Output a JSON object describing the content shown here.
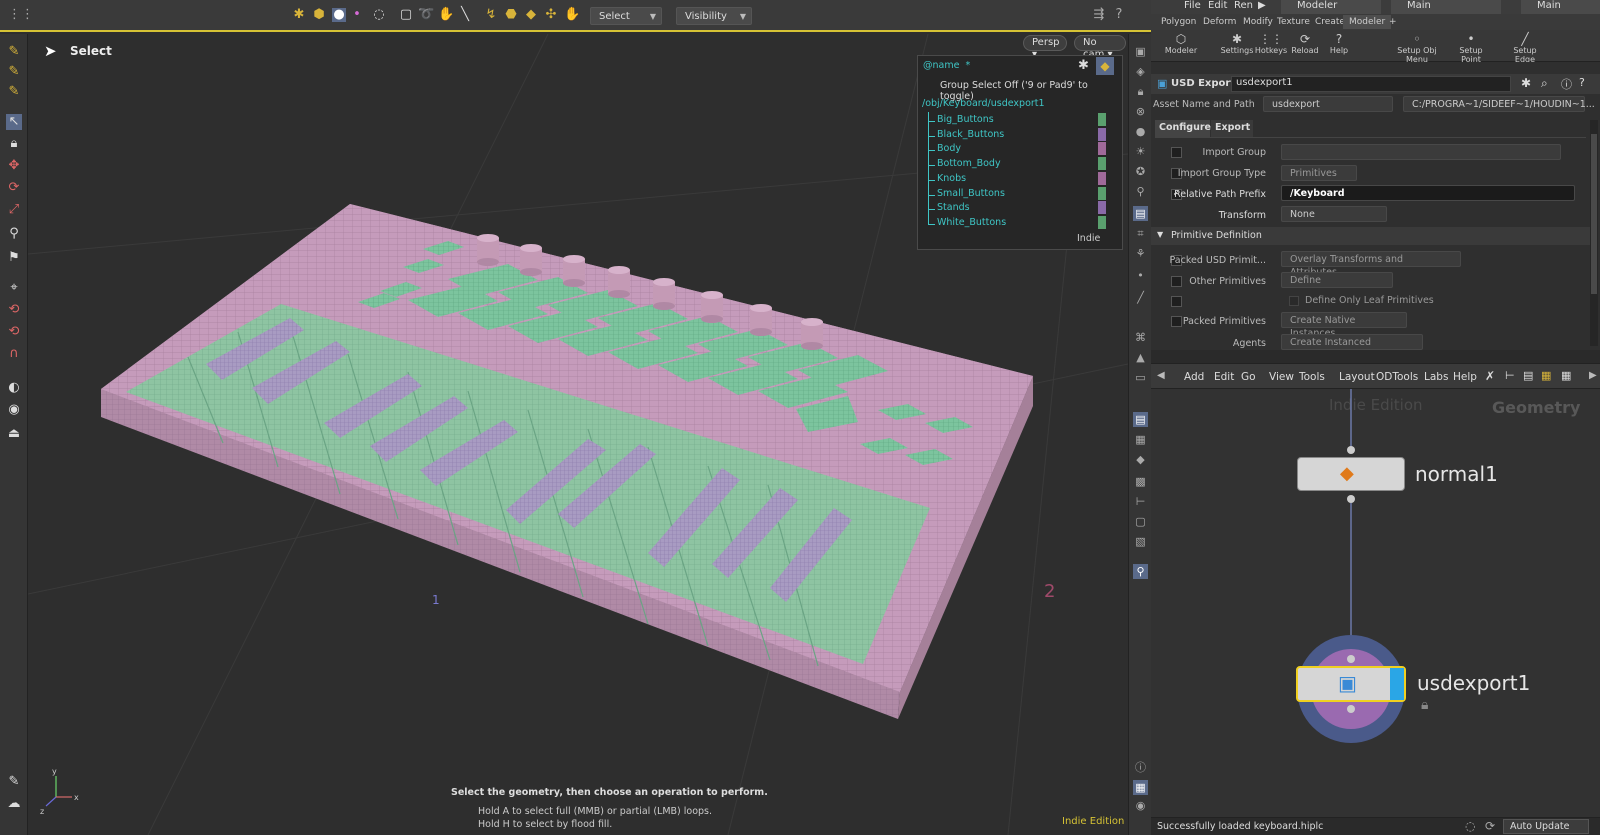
{
  "viewport": {
    "tool_title": "Select",
    "selection_mode": "Select",
    "visibility": "Visibility",
    "persp": "Persp",
    "cam": "No cam",
    "hint_main": "Select the geometry, then choose an operation to perform.",
    "hint_line1": "Hold A to select full (MMB) or partial (LMB) loops.",
    "hint_line2": "Hold H to select by flood fill.",
    "edition": "Indie Edition",
    "grid_labels": [
      "1",
      "2"
    ],
    "axis_labels": {
      "y": "y",
      "x": "x",
      "z": "z"
    }
  },
  "outliner": {
    "filter": "@name",
    "filter_wildcard": "*",
    "group_select": "Group Select Off ('9 or Pad9' to toggle)",
    "root": "/obj/Keyboard/usdexport1",
    "items": [
      {
        "label": "Big_Buttons",
        "color": "#5aa06e"
      },
      {
        "label": "Black_Buttons",
        "color": "#8a6aa8"
      },
      {
        "label": "Body",
        "color": "#a06a9a"
      },
      {
        "label": "Bottom_Body",
        "color": "#5aa06e"
      },
      {
        "label": "Knobs",
        "color": "#a06a9a"
      },
      {
        "label": "Small_Buttons",
        "color": "#5aa06e"
      },
      {
        "label": "Stands",
        "color": "#8a6aa8"
      },
      {
        "label": "White_Buttons",
        "color": "#5aa06e"
      }
    ],
    "badge": "Indie"
  },
  "menubar": {
    "items": [
      "File",
      "Edit",
      "Ren"
    ],
    "desk": "Modeler",
    "view1": "Main",
    "view2": "Main"
  },
  "shelf_tabs": [
    "Polygon",
    "Deform",
    "Modify",
    "Texture",
    "Create",
    "Modeler"
  ],
  "shelf_tools": [
    {
      "label": "Modeler",
      "icon": "cube-icon"
    },
    {
      "label": "Settings",
      "icon": "gear-icon"
    },
    {
      "label": "Hotkeys",
      "icon": "grid-icon"
    },
    {
      "label": "Reload",
      "icon": "reload-icon"
    },
    {
      "label": "Help",
      "icon": "help-icon"
    },
    {
      "label": "Setup Obj Menu",
      "icon": "obj-icon"
    },
    {
      "label": "Setup Point Menu",
      "icon": "point-icon"
    },
    {
      "label": "Setup Edge Menu",
      "icon": "edge-icon"
    }
  ],
  "params": {
    "node_type": "USD Export",
    "node_name": "usdexport1",
    "asset_label": "Asset Name and Path",
    "asset_name": "usdexport",
    "asset_path": "C:/PROGRA~1/SIDEEF~1/HOUDIN~1...",
    "tabs": [
      "Configure",
      "Export"
    ],
    "import_group": "Import Group",
    "import_group_type": "Import Group Type",
    "import_group_type_val": "Primitives",
    "relative_path_prefix": "Relative Path Prefix",
    "relative_path_value": "/Keyboard",
    "transform": "Transform",
    "transform_val": "None",
    "section": "Primitive Definition",
    "packed_usd": "Packed USD Primit...",
    "packed_usd_val": "Overlay Transforms and Attributes",
    "other_prims": "Other Primitives",
    "other_prims_val": "Define",
    "define_leaf": "Define Only Leaf Primitives",
    "packed_prims": "Packed Primitives",
    "packed_prims_val": "Create Native Instances",
    "agents": "Agents",
    "agents_val": "Create Instanced SkelRoots"
  },
  "network": {
    "menu": [
      "Add",
      "Edit",
      "Go",
      "View",
      "Tools",
      "Layout",
      "ODTools",
      "Labs",
      "Help"
    ],
    "watermark": "Indie Edition",
    "context": "Geometry",
    "node1": "normal1",
    "node2": "usdexport1"
  },
  "status": {
    "message": "Successfully loaded keyboard.hiplc",
    "update_mode": "Auto Update"
  }
}
